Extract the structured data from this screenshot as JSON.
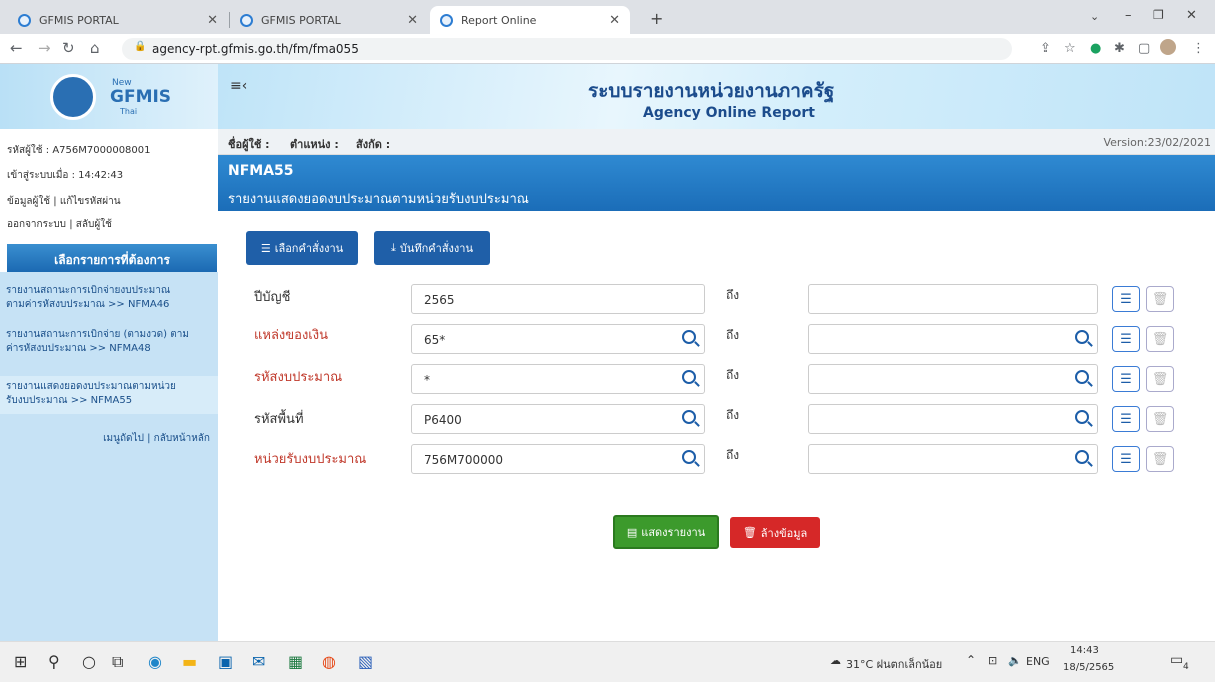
{
  "browser": {
    "tabs": [
      {
        "label": "GFMIS PORTAL"
      },
      {
        "label": "GFMIS PORTAL"
      },
      {
        "label": "Report Online"
      }
    ],
    "url": "agency-rpt.gfmis.go.th/fm/fma055"
  },
  "logo": {
    "top": "New",
    "main": "GFMIS",
    "sub": "Thai"
  },
  "banner": {
    "title_th": "ระบบรายงานหน่วยงานภาครัฐ",
    "title_en": "Agency Online Report"
  },
  "user": {
    "id": "รหัสผู้ใช้ : A756M7000008001",
    "login_time": "เข้าสู่ระบบเมื่อ : 14:42:43",
    "profile": "ข้อมูลผู้ใช้",
    "change_password": "แก้ไขรหัสผ่าน",
    "logout": "ออกจากระบบ",
    "switch_user": "สลับผู้ใช้"
  },
  "menu": {
    "header": "เลือกรายการที่ต้องการ",
    "items": [
      {
        "line1": "รายงานสถานะการเบิกจ่ายงบประมาณ",
        "line2": "ตามค่ารหัสงบประมาณ >> NFMA46"
      },
      {
        "line1": "รายงานสถานะการเบิกจ่าย (ตามงวด) ตาม",
        "line2": "ค่ารหัสงบประมาณ >> NFMA48"
      },
      {
        "line1": "รายงานแสดงยอดงบประมาณตามหน่วย",
        "line2": "รับงบประมาณ >> NFMA55"
      }
    ],
    "footer": "เมนูถัดไป | กลับหน้าหลัก"
  },
  "infobar": {
    "username_label": "ชื่อผู้ใช้ :",
    "position_label": "ตำแหน่ง :",
    "affiliation_label": "สังกัด :",
    "version": "Version:23/02/2021"
  },
  "report": {
    "code": "NFMA55",
    "title": "รายงานแสดงยอดงบประมาณตามหน่วยรับงบประมาณ"
  },
  "actions": {
    "select_command": "เลือกคำสั่งงาน",
    "save_command": "บันทึกคำสั่งงาน",
    "show_report": "แสดงรายงาน",
    "clear_data": "ล้างข้อมูล"
  },
  "form": {
    "to_label": "ถึง",
    "rows": [
      {
        "label": "ปีบัญชี",
        "value": "2565",
        "to_value": ""
      },
      {
        "label": "แหล่งของเงิน",
        "value": "65*",
        "to_value": ""
      },
      {
        "label": "รหัสงบประมาณ",
        "value": "*",
        "to_value": ""
      },
      {
        "label": "รหัสพื้นที่",
        "value": "P6400",
        "to_value": ""
      },
      {
        "label": "หน่วยรับงบประมาณ",
        "value": "756M700000",
        "to_value": ""
      }
    ]
  },
  "taskbar": {
    "weather": "31°C ฝนตกเล็กน้อย",
    "lang": "ENG",
    "time": "14:43",
    "date": "18/5/2565",
    "notifications": "4"
  },
  "colors": {
    "label_black": "#333333",
    "label_red": "#c0392b",
    "title_blue": "#1b6db8",
    "show_green": "#3c9a2c",
    "clear_red": "#d62828"
  }
}
